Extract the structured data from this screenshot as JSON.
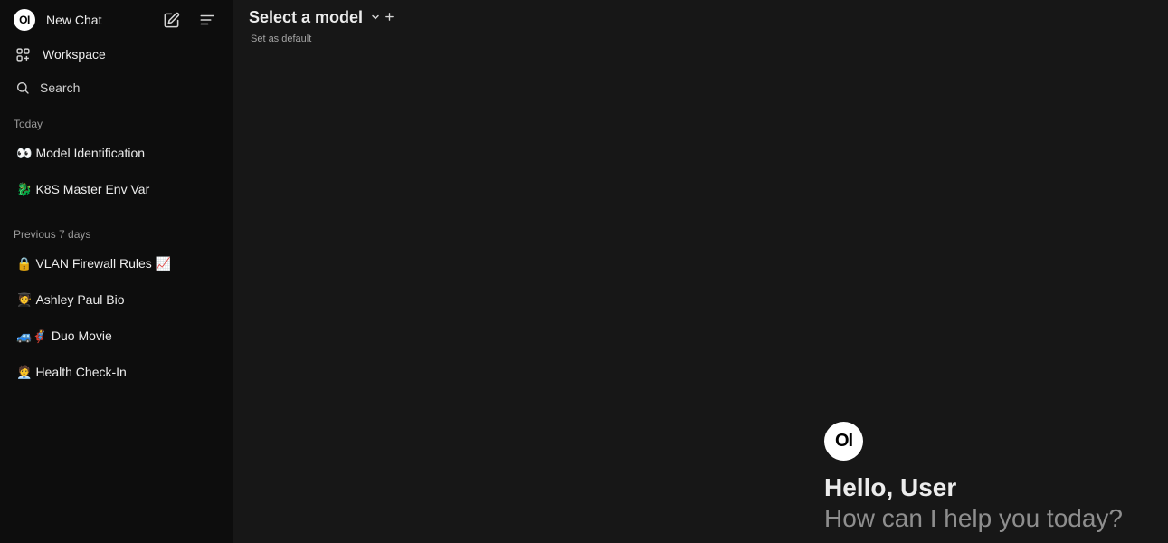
{
  "sidebar": {
    "logo_text": "OI",
    "new_chat_label": "New Chat",
    "workspace_label": "Workspace",
    "search_label": "Search",
    "sections": [
      {
        "label": "Today",
        "chats": [
          {
            "emoji": "👀",
            "title": "Model Identification"
          },
          {
            "emoji": "🐉",
            "title": "K8S Master Env Var"
          }
        ]
      },
      {
        "label": "Previous 7 days",
        "chats": [
          {
            "emoji": "🔒",
            "title": "VLAN Firewall Rules 📈"
          },
          {
            "emoji": "🧑‍🎓",
            "title": "Ashley Paul Bio"
          },
          {
            "emoji": "🚙🦸",
            "title": "Duo Movie"
          },
          {
            "emoji": "🧑‍💼",
            "title": "Health Check-In"
          }
        ]
      }
    ]
  },
  "header": {
    "model_select_label": "Select a model",
    "set_default_label": "Set as default"
  },
  "welcome": {
    "logo_text": "OI",
    "greeting": "Hello, User",
    "prompt": "How can I help you today?"
  },
  "colors": {
    "sidebar_bg": "#0d0d0d",
    "main_bg": "#171717",
    "text": "#ececec",
    "muted": "#9b9b9b"
  }
}
